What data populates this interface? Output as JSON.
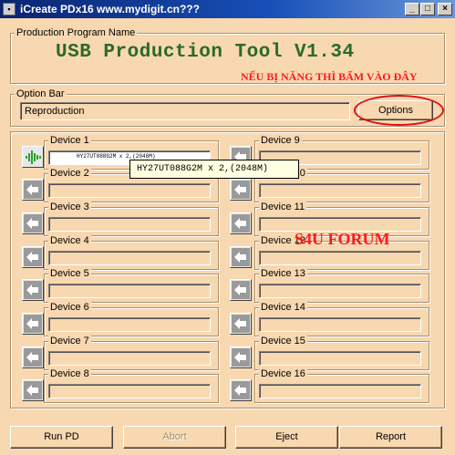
{
  "window": {
    "title": "iCreate PDx16 www.mydigit.cn???",
    "controls": {
      "minimize": "_",
      "maximize": "□",
      "close": "×"
    }
  },
  "program_group": {
    "label": "Production Program Name",
    "headline": "USB Production Tool V1.34",
    "note": "NẾU BỊ NĂNG THÌ BẤM VÀO ĐÂY"
  },
  "option_bar": {
    "label": "Option Bar",
    "value": "Reproduction",
    "options_button": "Options"
  },
  "devices_left": [
    {
      "label": "Device 1",
      "value": "HY27UT088G2M x 2,(2048M)",
      "icon": "usb-active-icon",
      "active": true
    },
    {
      "label": "Device 2",
      "value": "",
      "icon": "arrow-left-icon"
    },
    {
      "label": "Device 3",
      "value": "",
      "icon": "arrow-left-icon"
    },
    {
      "label": "Device 4",
      "value": "",
      "icon": "arrow-left-icon"
    },
    {
      "label": "Device 5",
      "value": "",
      "icon": "arrow-left-icon"
    },
    {
      "label": "Device 6",
      "value": "",
      "icon": "arrow-left-icon"
    },
    {
      "label": "Device 7",
      "value": "",
      "icon": "arrow-left-icon"
    },
    {
      "label": "Device 8",
      "value": "",
      "icon": "arrow-left-icon"
    }
  ],
  "devices_right": [
    {
      "label": "Device 9",
      "value": "",
      "icon": "arrow-left-icon"
    },
    {
      "label": "Device 10",
      "value": "",
      "icon": "arrow-left-icon"
    },
    {
      "label": "Device 11",
      "value": "",
      "icon": "arrow-left-icon"
    },
    {
      "label": "Device 12",
      "value": "",
      "icon": "arrow-left-icon"
    },
    {
      "label": "Device 13",
      "value": "",
      "icon": "arrow-left-icon"
    },
    {
      "label": "Device 14",
      "value": "",
      "icon": "arrow-left-icon"
    },
    {
      "label": "Device 15",
      "value": "",
      "icon": "arrow-left-icon"
    },
    {
      "label": "Device 16",
      "value": "",
      "icon": "arrow-left-icon"
    }
  ],
  "tooltip": "HY27UT088G2M x 2,(2048M)",
  "watermark": "S4U FORUM",
  "buttons": {
    "run": "Run PD",
    "abort": "Abort",
    "eject": "Eject",
    "report": "Report"
  },
  "colors": {
    "window_bg": "#f8d8b0",
    "headline": "#2a6a2a",
    "annotation_red": "#ff1a1a",
    "active_device": "#2aa02a"
  }
}
